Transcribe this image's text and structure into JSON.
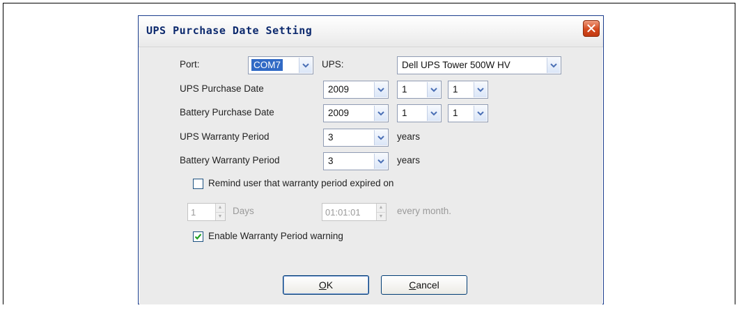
{
  "dialog": {
    "title": "UPS Purchase Date Setting",
    "close_glyph": "✕"
  },
  "port": {
    "label": "Port:",
    "value": "COM7"
  },
  "ups": {
    "label": "UPS:",
    "value": "Dell UPS Tower 500W HV"
  },
  "ups_purchase_date": {
    "label": "UPS Purchase Date",
    "year": "2009",
    "month": "1",
    "day": "1"
  },
  "battery_purchase_date": {
    "label": "Battery Purchase Date",
    "year": "2009",
    "month": "1",
    "day": "1"
  },
  "ups_warranty": {
    "label": "UPS Warranty Period",
    "value": "3",
    "unit": "years"
  },
  "battery_warranty": {
    "label": "Battery Warranty Period",
    "value": "3",
    "unit": "years"
  },
  "remind": {
    "label": "Remind user that warranty period expired on",
    "checked": false,
    "days_value": "1",
    "days_label": "Days",
    "time_value": "01:01:01",
    "time_suffix": "every month."
  },
  "enable_warning": {
    "label": "Enable Warranty Period warning",
    "checked": true
  },
  "buttons": {
    "ok_mnemonic": "O",
    "ok_rest": "K",
    "cancel_mnemonic": "C",
    "cancel_rest": "ancel"
  },
  "colors": {
    "title_text": "#0d2a6e",
    "selection": "#316ac5",
    "close_button": "#d44a1e",
    "check_mark": "#21a121"
  },
  "icons": {
    "dropdown": "chevron-down-icon",
    "close": "close-icon",
    "checkmark": "checkmark-icon",
    "spin": "spin-arrows-icon"
  }
}
